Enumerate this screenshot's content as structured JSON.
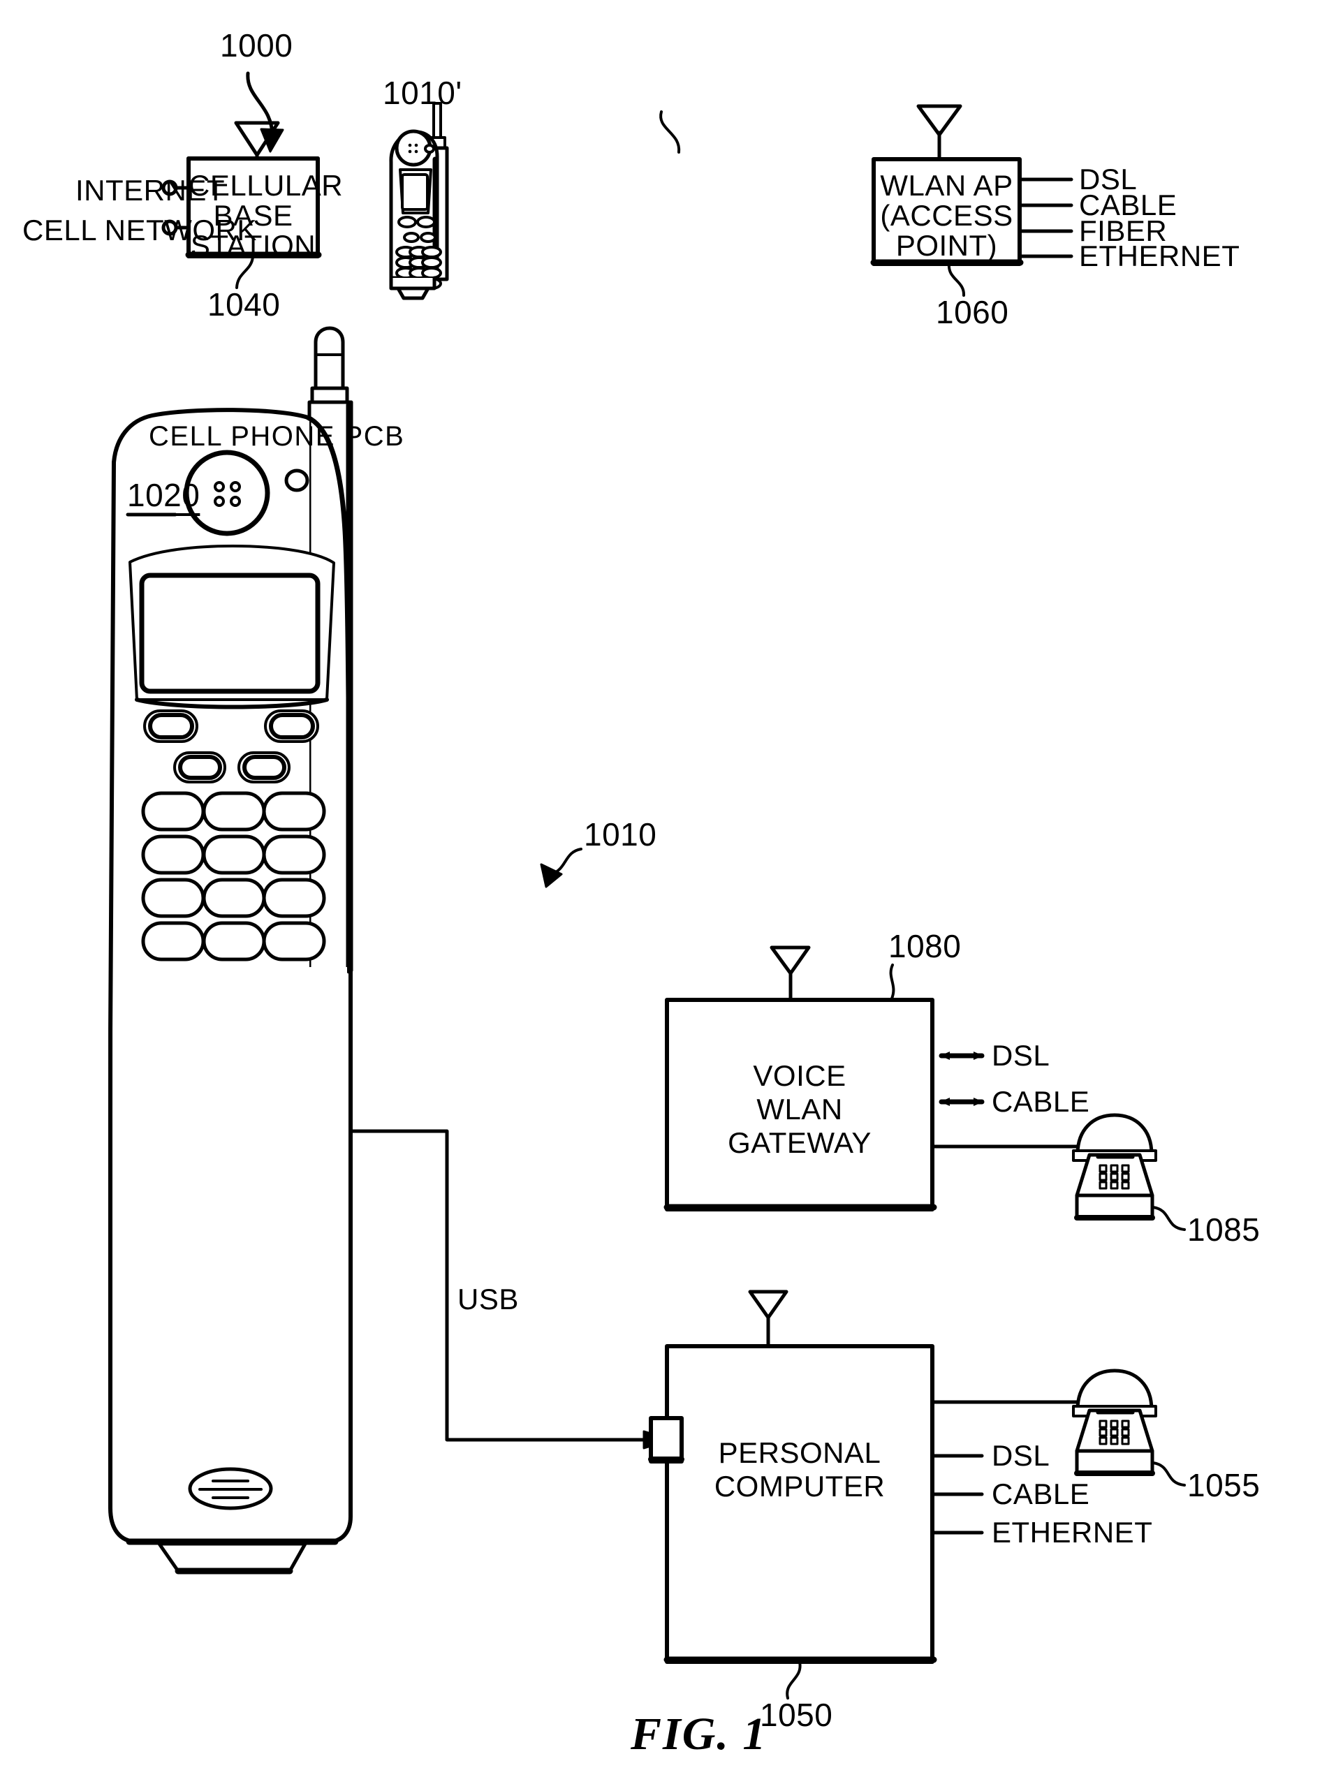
{
  "figure": {
    "caption": "FIG. 1",
    "system_ref": "1000"
  },
  "blocks": {
    "cellular_base_station": {
      "ref": "1040",
      "line1": "CELLULAR",
      "line2": "BASE",
      "line3": "STATION",
      "inputs": [
        {
          "label": "INTERNET"
        },
        {
          "label": "CELL NETWORK"
        }
      ]
    },
    "wlan_ap": {
      "ref": "1060",
      "line1": "WLAN AP",
      "line2": "(ACCESS",
      "line3": "POINT)",
      "outputs": [
        {
          "label": "DSL"
        },
        {
          "label": "CABLE"
        },
        {
          "label": "FIBER"
        },
        {
          "label": "ETHERNET"
        }
      ]
    },
    "voice_wlan_gateway": {
      "ref": "1080",
      "line1": "VOICE",
      "line2": "WLAN",
      "line3": "GATEWAY",
      "bidirectional_ports": [
        {
          "label": "DSL"
        },
        {
          "label": "CABLE"
        }
      ],
      "attached_phone_ref": "1085"
    },
    "personal_computer": {
      "ref": "1050",
      "line1": "PERSONAL",
      "line2": "COMPUTER",
      "outputs": [
        {
          "label": "DSL"
        },
        {
          "label": "CABLE"
        },
        {
          "label": "ETHERNET"
        }
      ],
      "attached_phone_ref": "1055"
    }
  },
  "devices": {
    "small_cell_phone": {
      "ref": "1010'"
    },
    "large_cell_phone": {
      "ref": "1010",
      "pcb_label": "CELL PHONE PCB",
      "pcb_ref": "1020"
    }
  },
  "connections": {
    "usb": {
      "label": "USB"
    }
  }
}
